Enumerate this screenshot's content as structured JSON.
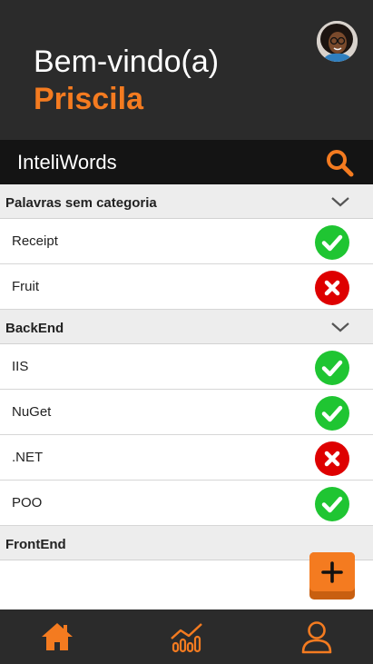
{
  "header": {
    "greeting": "Bem-vindo(a)",
    "username": "Priscila",
    "avatar_icon": "user-photo",
    "background": "#2b2b2b",
    "accent": "#f47b20"
  },
  "appbar": {
    "title": "InteliWords",
    "search_icon": "search-icon"
  },
  "categories": [
    {
      "name": "Palavras sem categoria",
      "expanded": true,
      "words": [
        {
          "word": "Receipt",
          "status": "correct"
        },
        {
          "word": "Fruit",
          "status": "wrong"
        }
      ]
    },
    {
      "name": "BackEnd",
      "expanded": true,
      "words": [
        {
          "word": "IIS",
          "status": "correct"
        },
        {
          "word": "NuGet",
          "status": "correct"
        },
        {
          "word": ".NET",
          "status": "wrong"
        },
        {
          "word": "POO",
          "status": "correct"
        }
      ]
    },
    {
      "name": "FrontEnd",
      "expanded": false,
      "words": []
    }
  ],
  "fab": {
    "icon": "plus-icon"
  },
  "bottom_nav": [
    {
      "icon": "home-icon"
    },
    {
      "icon": "chart-icon"
    },
    {
      "icon": "profile-icon"
    }
  ],
  "colors": {
    "correct": "#1fc532",
    "wrong": "#de0000",
    "category_bg": "#ededed",
    "nav_bg": "#2b2b2b"
  }
}
